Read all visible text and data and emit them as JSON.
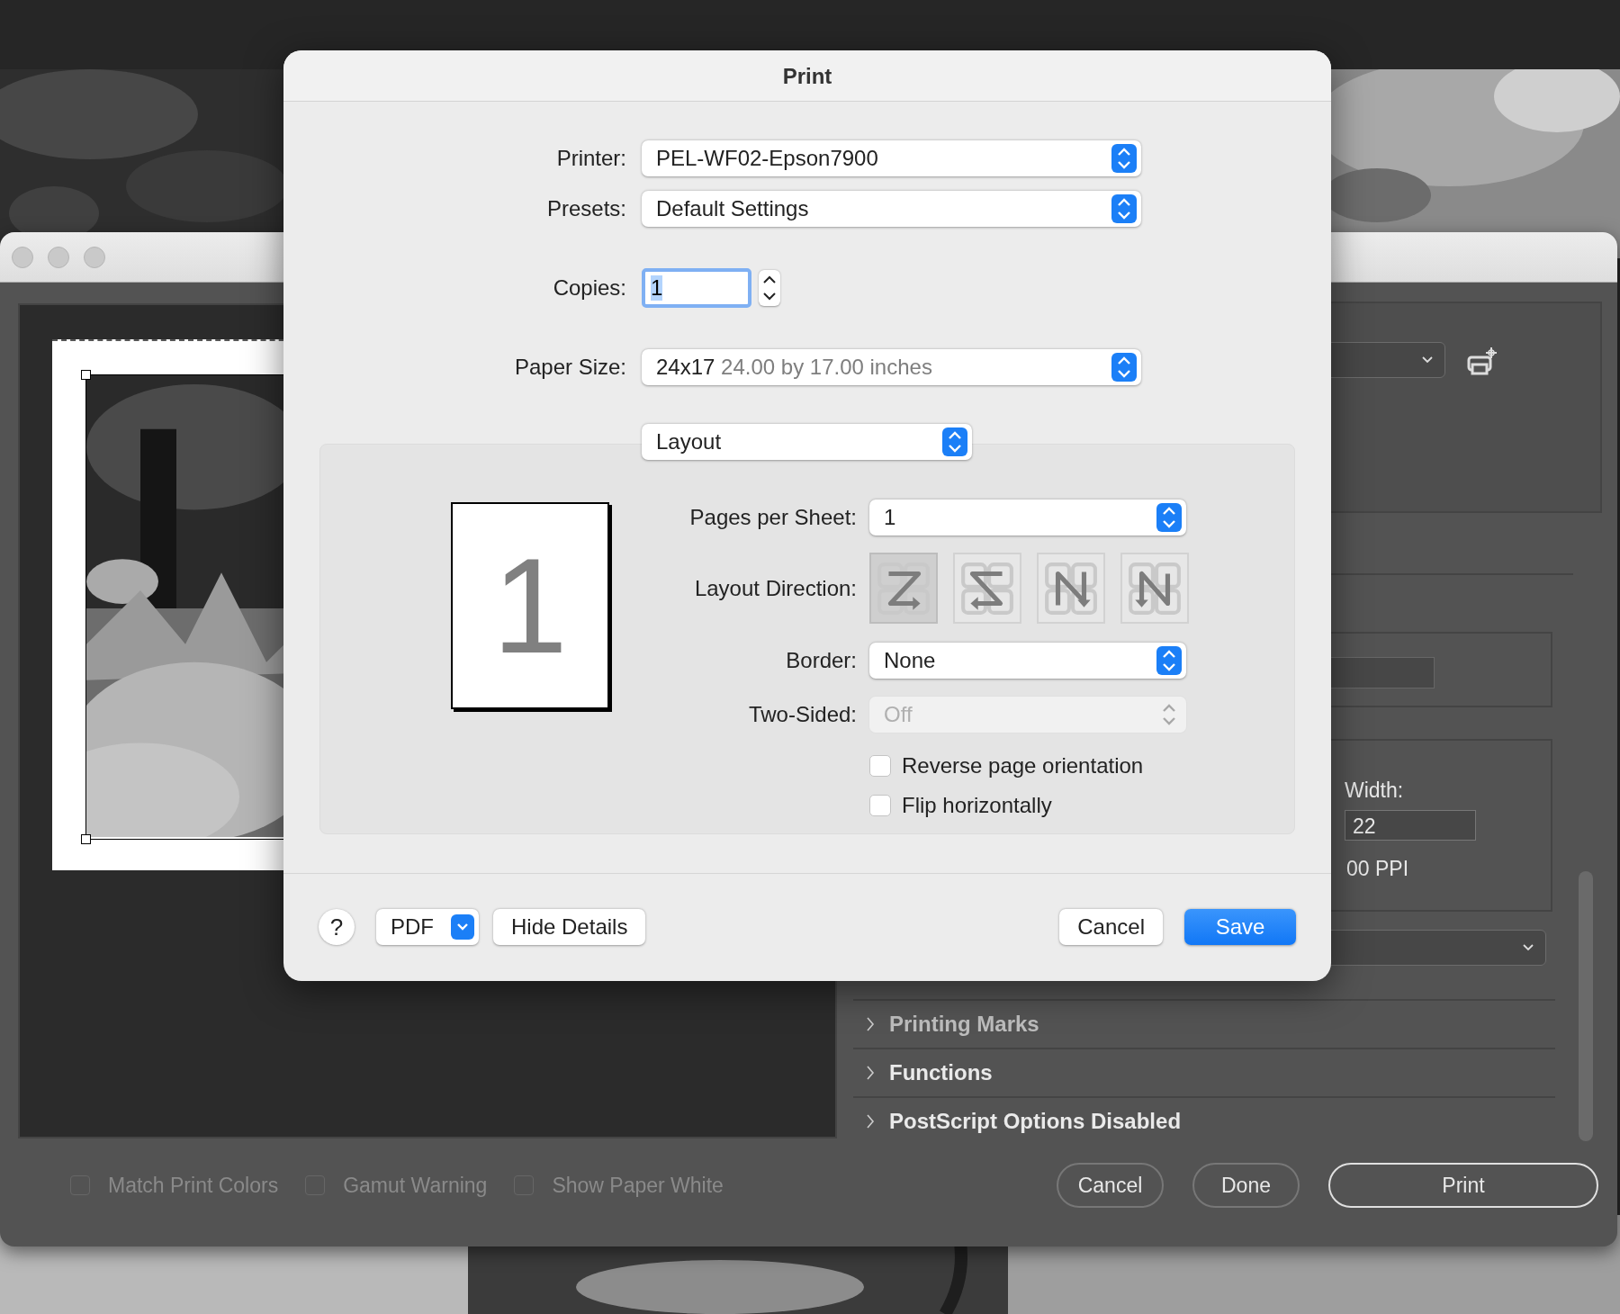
{
  "dialog": {
    "title": "Print",
    "printer": {
      "label": "Printer:",
      "value": "PEL-WF02-Epson7900"
    },
    "presets": {
      "label": "Presets:",
      "value": "Default Settings"
    },
    "copies": {
      "label": "Copies:",
      "value": "1"
    },
    "paper_size": {
      "label": "Paper Size:",
      "value": "24x17",
      "detail": "24.00 by 17.00 inches"
    },
    "section": {
      "value": "Layout"
    },
    "layout": {
      "page_number": "1",
      "pages_per_sheet": {
        "label": "Pages per Sheet:",
        "value": "1"
      },
      "direction": {
        "label": "Layout Direction:",
        "options": [
          {
            "kind": "z",
            "selected": true
          },
          {
            "kind": "z-reverse",
            "selected": false
          },
          {
            "kind": "n-reverse",
            "selected": false
          },
          {
            "kind": "n",
            "selected": false
          }
        ]
      },
      "border": {
        "label": "Border:",
        "value": "None"
      },
      "two_sided": {
        "label": "Two-Sided:",
        "value": "Off",
        "disabled": true
      },
      "checkboxes": [
        {
          "label": "Reverse page orientation",
          "checked": false
        },
        {
          "label": "Flip horizontally",
          "checked": false
        }
      ]
    },
    "help": "?",
    "pdf": "PDF",
    "details_button": "Hide Details",
    "buttons": [
      {
        "label": "Cancel",
        "kind": "normal"
      },
      {
        "label": "Save",
        "kind": "primary"
      }
    ]
  },
  "back_window": {
    "width": {
      "label": "Width:",
      "value": "22"
    },
    "resolution": "00 PPI",
    "sections": [
      {
        "label": "Printing Marks",
        "expanded": false
      },
      {
        "label": "Functions",
        "expanded": false
      },
      {
        "label": "PostScript Options Disabled",
        "expanded": false
      }
    ],
    "options": [
      {
        "label": "Match Print Colors",
        "checked": false,
        "disabled": true
      },
      {
        "label": "Gamut Warning",
        "checked": false,
        "disabled": true
      },
      {
        "label": "Show Paper White",
        "checked": false,
        "disabled": true
      }
    ],
    "buttons": [
      {
        "label": "Cancel",
        "kind": "normal"
      },
      {
        "label": "Done",
        "kind": "normal"
      },
      {
        "label": "Print",
        "kind": "default"
      }
    ]
  }
}
